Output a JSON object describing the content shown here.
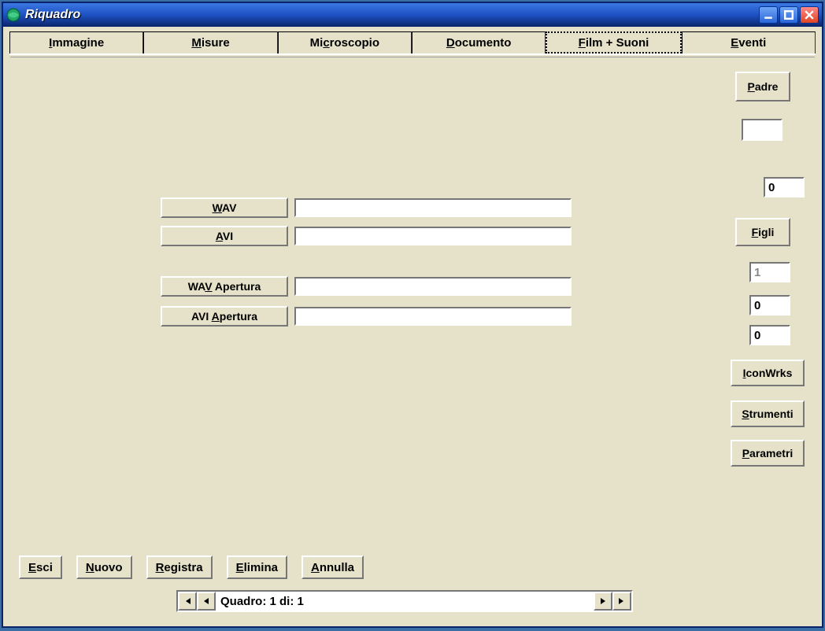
{
  "title": "Riquadro",
  "tabs": [
    {
      "label": "Immagine",
      "ukey": "I"
    },
    {
      "label": "Misure",
      "ukey": "M"
    },
    {
      "label": "Microscopio",
      "ukey": "c"
    },
    {
      "label": "Documento",
      "ukey": "D"
    },
    {
      "label": "Film + Suoni",
      "ukey": "F"
    },
    {
      "label": "Eventi",
      "ukey": "E"
    }
  ],
  "active_tab": 4,
  "fields": {
    "wav": {
      "label": "WAV",
      "value": ""
    },
    "avi": {
      "label": "AVI",
      "value": ""
    },
    "wav_apertura": {
      "label": "WAV Apertura",
      "value": ""
    },
    "avi_apertura": {
      "label": "AVI Apertura",
      "value": ""
    }
  },
  "side": {
    "padre": "Padre",
    "padre_input": "",
    "padre_value": "0",
    "figli": "Figli",
    "figli_v1": "1",
    "figli_v2": "0",
    "figli_v3": "0",
    "iconwrks": "IconWrks",
    "strumenti": "Strumenti",
    "parametri": "Parametri"
  },
  "bottom": {
    "esci": "Esci",
    "nuovo": "Nuovo",
    "registra": "Registra",
    "elimina": "Elimina",
    "annulla": "Annulla"
  },
  "nav": {
    "text": "Quadro: 1 di: 1"
  }
}
